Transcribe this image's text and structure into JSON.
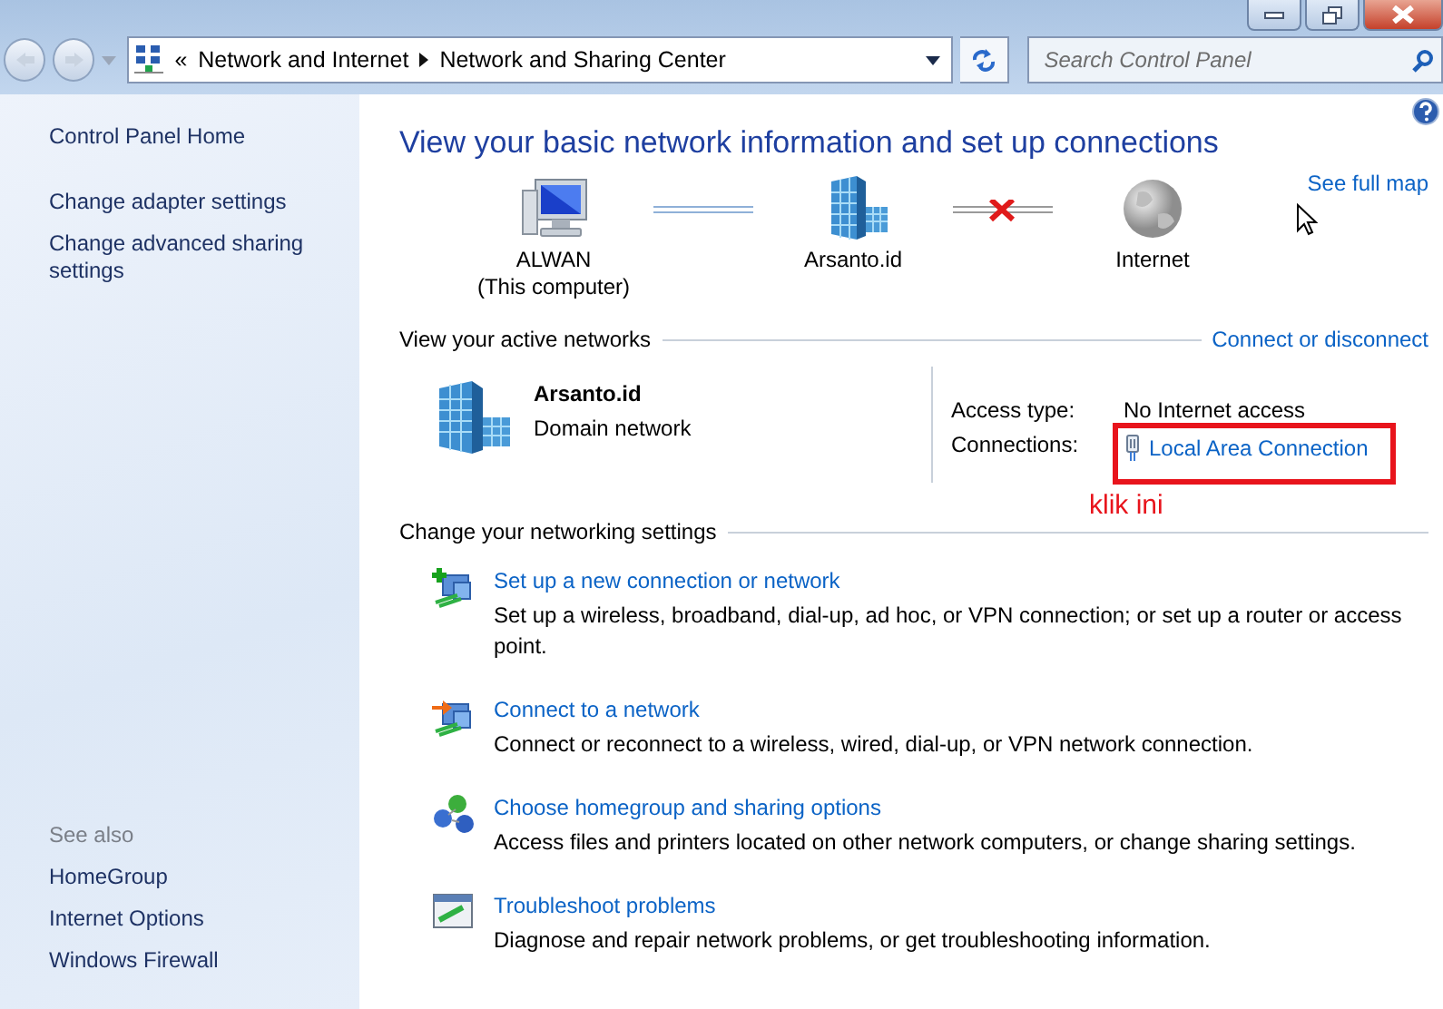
{
  "address_bar": {
    "overflow": "«",
    "crumbs": [
      "Network and Internet",
      "Network and Sharing Center"
    ]
  },
  "search": {
    "placeholder": "Search Control Panel"
  },
  "sidebar": {
    "links": [
      "Control Panel Home",
      "Change adapter settings",
      "Change advanced sharing settings"
    ],
    "see_also_heading": "See also",
    "see_also": [
      "HomeGroup",
      "Internet Options",
      "Windows Firewall"
    ]
  },
  "main": {
    "title": "View your basic network information and set up connections",
    "map": {
      "nodes": [
        {
          "kind": "computer",
          "label": "ALWAN",
          "sublabel": "(This computer)"
        },
        {
          "kind": "domain",
          "label": "Arsanto.id"
        },
        {
          "kind": "internet",
          "label": "Internet"
        }
      ],
      "links": [
        {
          "broken": false
        },
        {
          "broken": true
        }
      ],
      "see_full_map": "See full map"
    },
    "active_networks": {
      "heading": "View your active networks",
      "action": "Connect or disconnect",
      "networks": [
        {
          "name": "Arsanto.id",
          "type": "Domain network",
          "access_type_label": "Access type:",
          "access_type": "No Internet access",
          "connections_label": "Connections:",
          "connection": "Local Area Connection",
          "highlighted": true,
          "note": "klik ini"
        }
      ]
    },
    "settings": {
      "heading": "Change your networking settings",
      "tasks": [
        {
          "kind": "new-connection",
          "title": "Set up a new connection or network",
          "description": "Set up a wireless, broadband, dial-up, ad hoc, or VPN connection; or set up a router or access point."
        },
        {
          "kind": "connect",
          "title": "Connect to a network",
          "description": "Connect or reconnect to a wireless, wired, dial-up, or VPN network connection."
        },
        {
          "kind": "homegroup",
          "title": "Choose homegroup and sharing options",
          "description": "Access files and printers located on other network computers, or change sharing settings."
        },
        {
          "kind": "troubleshoot",
          "title": "Troubleshoot problems",
          "description": "Diagnose and repair network problems, or get troubleshooting information."
        }
      ]
    }
  }
}
